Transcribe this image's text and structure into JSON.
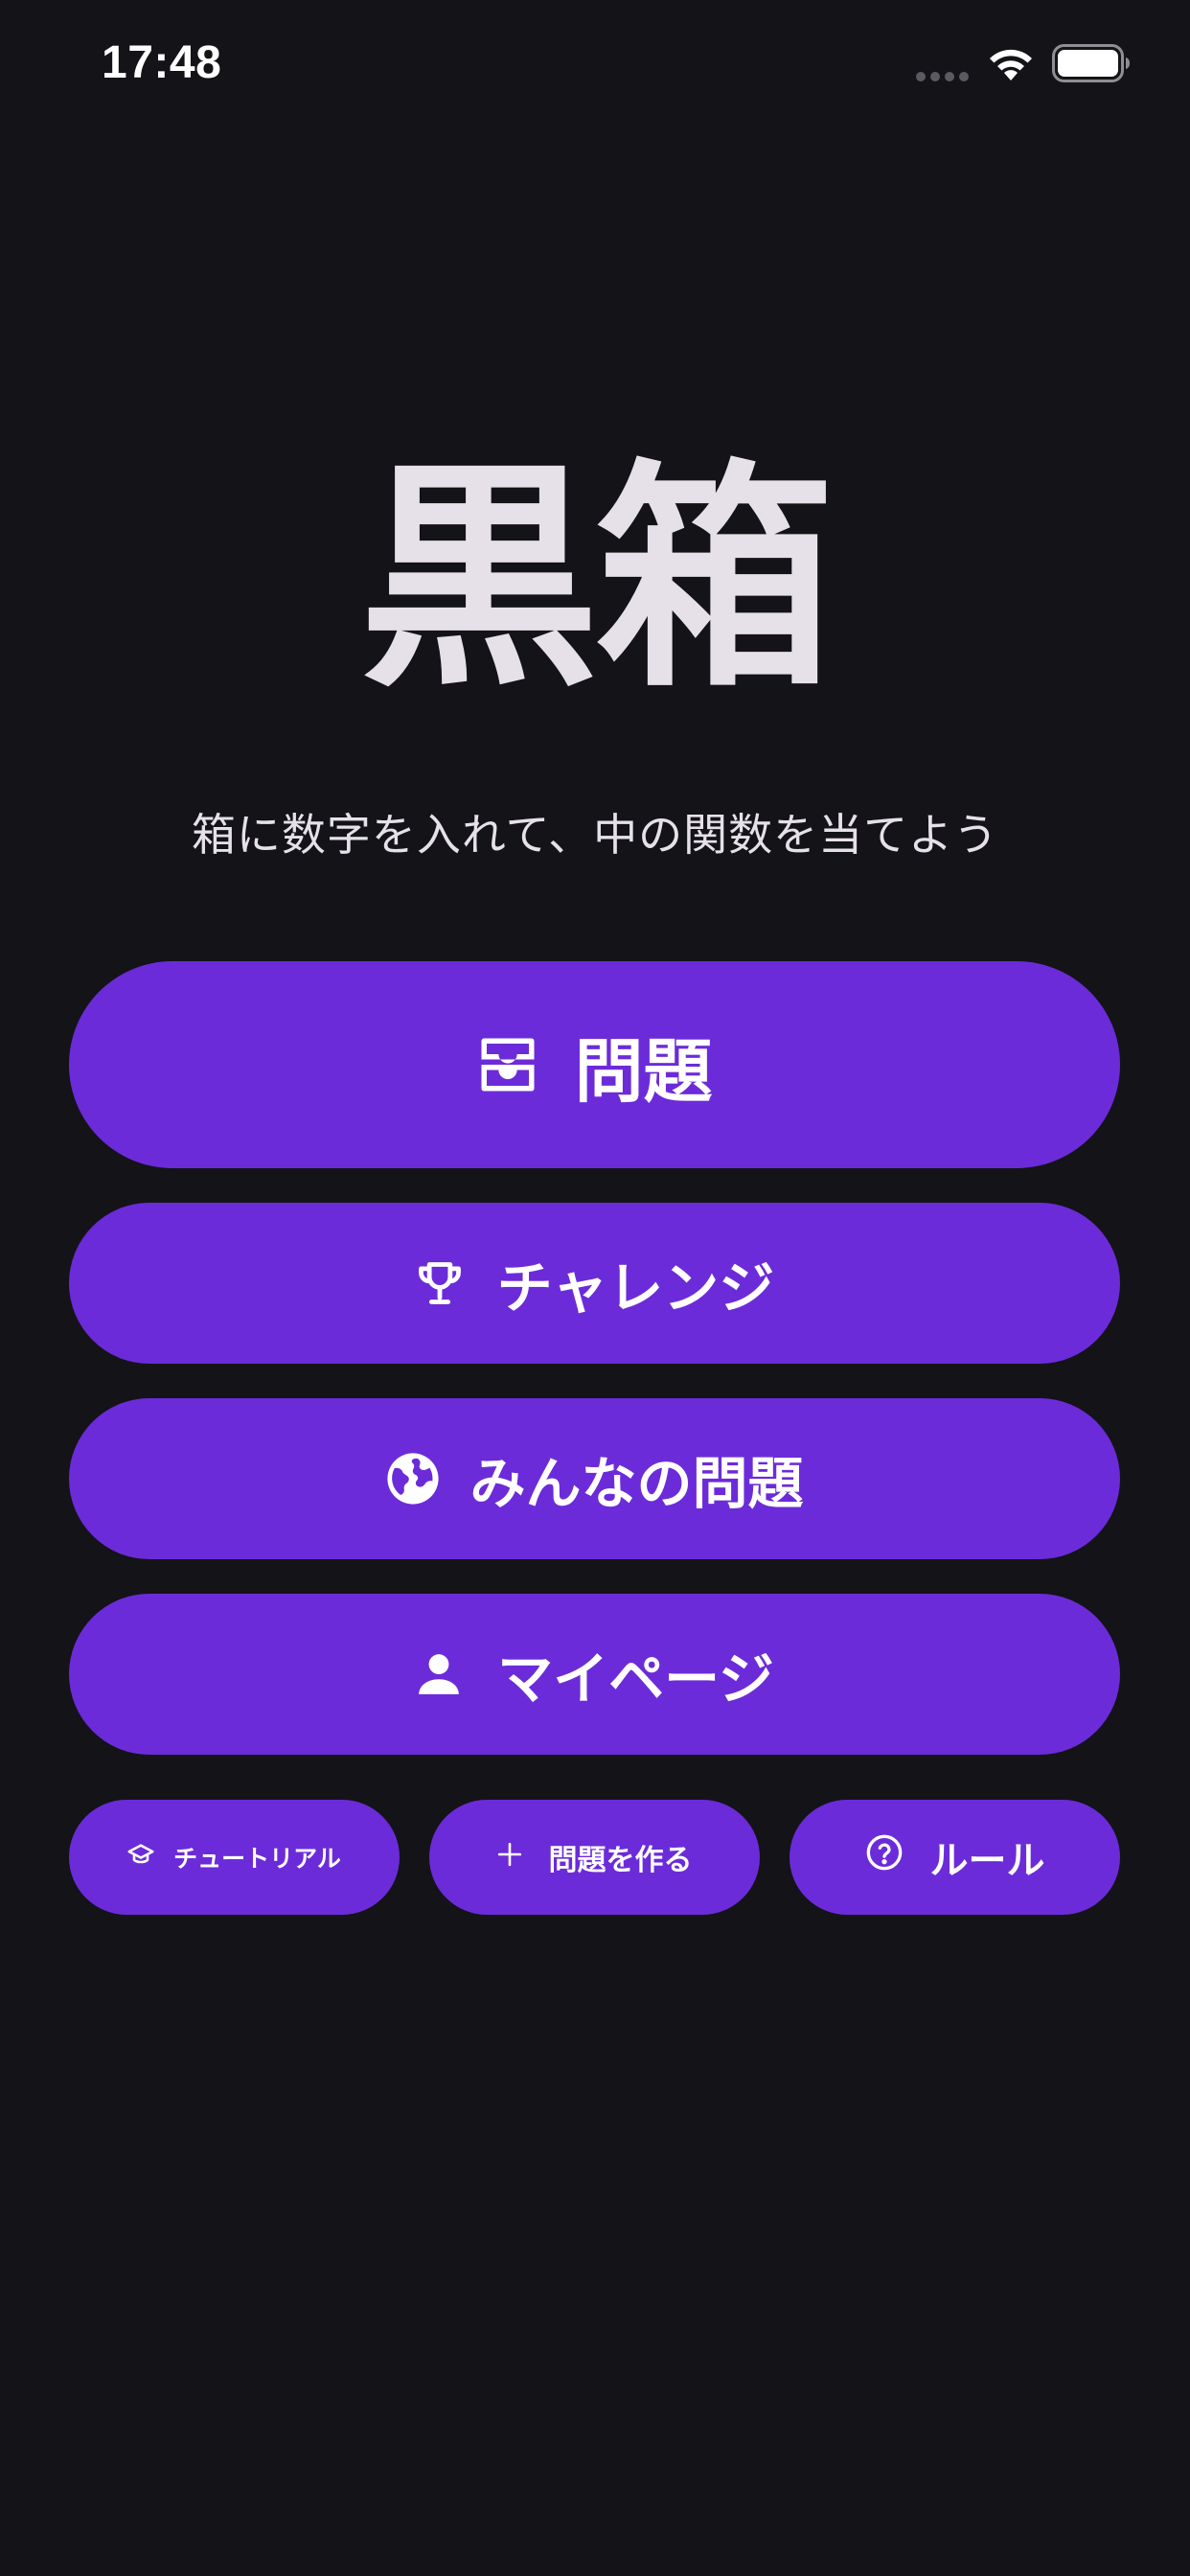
{
  "status_bar": {
    "time": "17:48"
  },
  "app": {
    "title": "黒箱",
    "subtitle": "箱に数字を入れて、中の関数を当てよう"
  },
  "menu": {
    "problems": {
      "label": "問題",
      "icon": "inbox-tray-icon"
    },
    "challenge": {
      "label": "チャレンジ",
      "icon": "trophy-icon"
    },
    "community": {
      "label": "みんなの問題",
      "icon": "globe-icon"
    },
    "mypage": {
      "label": "マイページ",
      "icon": "person-icon"
    }
  },
  "secondary": {
    "tutorial": {
      "label": "チュートリアル",
      "icon": "graduation-cap-icon"
    },
    "create": {
      "label": "問題を作る",
      "icon": "plus-icon"
    },
    "rules": {
      "label": "ルール",
      "icon": "help-circle-icon"
    }
  },
  "colors": {
    "background": "#131318",
    "button": "#6c2bd9",
    "title_text": "#e6e1e8"
  }
}
